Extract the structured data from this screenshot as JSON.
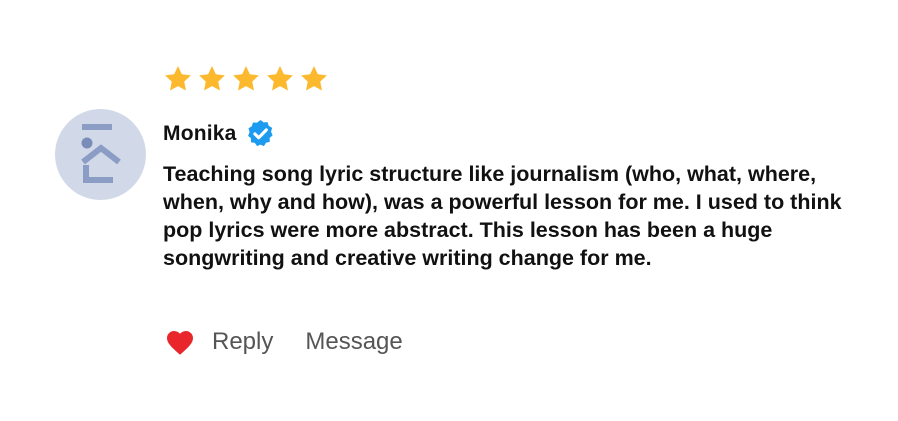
{
  "review": {
    "rating": 5,
    "rating_max": 5,
    "star_color": "#fdb92e",
    "author": {
      "name": "Monika",
      "verified": true,
      "verified_badge_color": "#1d9bf0",
      "avatar_icon": "logo-placeholder-icon",
      "avatar_bg": "#d1d9e9"
    },
    "text": "Teaching song lyric structure like journalism (who, what, where, when, why and how), was a powerful lesson for me. I used to think pop lyrics were more abstract. This lesson has been a huge songwriting and creative writing change for me.",
    "actions": {
      "like_icon": "heart-icon",
      "like_color": "#e8262b",
      "reply_label": "Reply",
      "message_label": "Message"
    }
  }
}
